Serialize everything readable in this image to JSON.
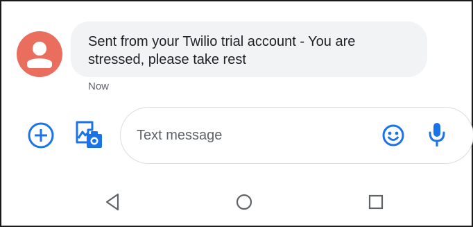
{
  "conversation": {
    "messages": [
      {
        "sender_avatar_color": "#ea6e5e",
        "text": "Sent from your Twilio trial account - You are stressed, please take rest",
        "timestamp": "Now"
      }
    ]
  },
  "compose": {
    "placeholder": "Text message",
    "icons": {
      "attach": "plus-circle-icon",
      "gallery": "gallery-icon",
      "emoji": "emoji-icon",
      "voice": "microphone-icon"
    }
  },
  "navigation_bar": {
    "icons": [
      "back-icon",
      "home-icon",
      "recent-apps-icon"
    ]
  },
  "colors": {
    "accent": "#1a73e8",
    "bubble": "#f1f3f4",
    "avatar": "#ea6e5e",
    "nav_icon": "#5f6368"
  }
}
